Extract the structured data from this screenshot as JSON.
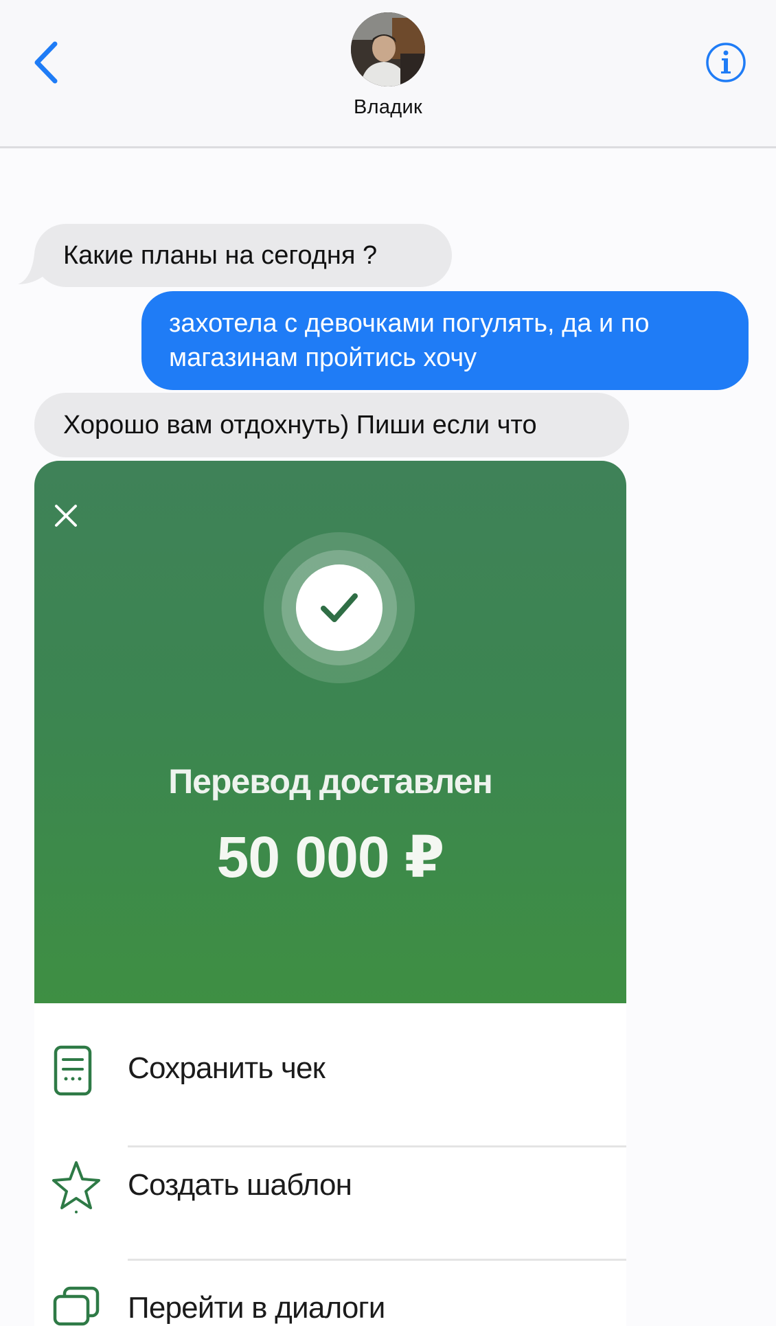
{
  "header": {
    "contact_name": "Владик",
    "back_icon": "chevron-left-icon",
    "info_icon": "info-icon",
    "accent_color": "#1f7cf6"
  },
  "messages": [
    {
      "direction": "incoming",
      "text": "Какие планы на сегодня ?"
    },
    {
      "direction": "outgoing",
      "text": "захотела с девочками погулять, да и по магазинам пройтись хочу"
    },
    {
      "direction": "incoming",
      "text": "Хорошо вам отдохнуть) Пиши если что"
    }
  ],
  "photo": {
    "title": "Перевод доставлен",
    "amount": "50 000 ₽",
    "close_icon": "close-icon",
    "status_icon": "checkmark-icon",
    "brand_color": "#3c8551",
    "actions": [
      {
        "label": "Сохранить чек",
        "icon": "receipt-icon"
      },
      {
        "label": "Создать шаблон",
        "icon": "star-icon"
      },
      {
        "label": "Перейти в диалоги",
        "icon": "dialogs-icon"
      }
    ]
  }
}
